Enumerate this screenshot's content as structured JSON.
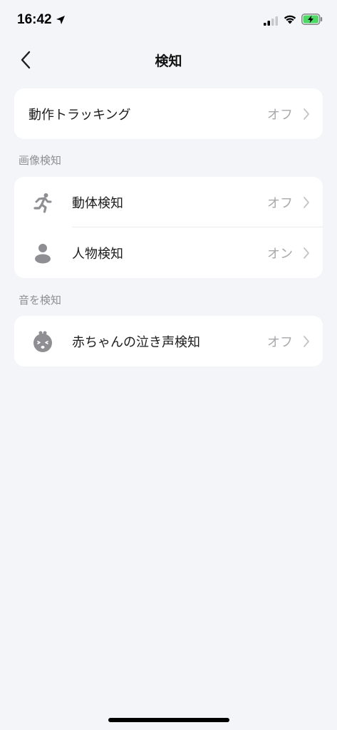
{
  "status_bar": {
    "time": "16:42"
  },
  "nav": {
    "title": "検知"
  },
  "motion_tracking": {
    "label": "動作トラッキング",
    "value": "オフ"
  },
  "image_detection": {
    "header": "画像検知",
    "items": [
      {
        "label": "動体検知",
        "value": "オフ",
        "icon": "running-person-icon"
      },
      {
        "label": "人物検知",
        "value": "オン",
        "icon": "person-icon"
      }
    ]
  },
  "sound_detection": {
    "header": "音を検知",
    "items": [
      {
        "label": "赤ちゃんの泣き声検知",
        "value": "オフ",
        "icon": "crying-baby-icon"
      }
    ]
  },
  "colors": {
    "background": "#f4f5f9",
    "card": "#ffffff",
    "secondary_text": "#a8a8ad",
    "icon_gray": "#8e8e93",
    "battery_green": "#4cd964"
  }
}
